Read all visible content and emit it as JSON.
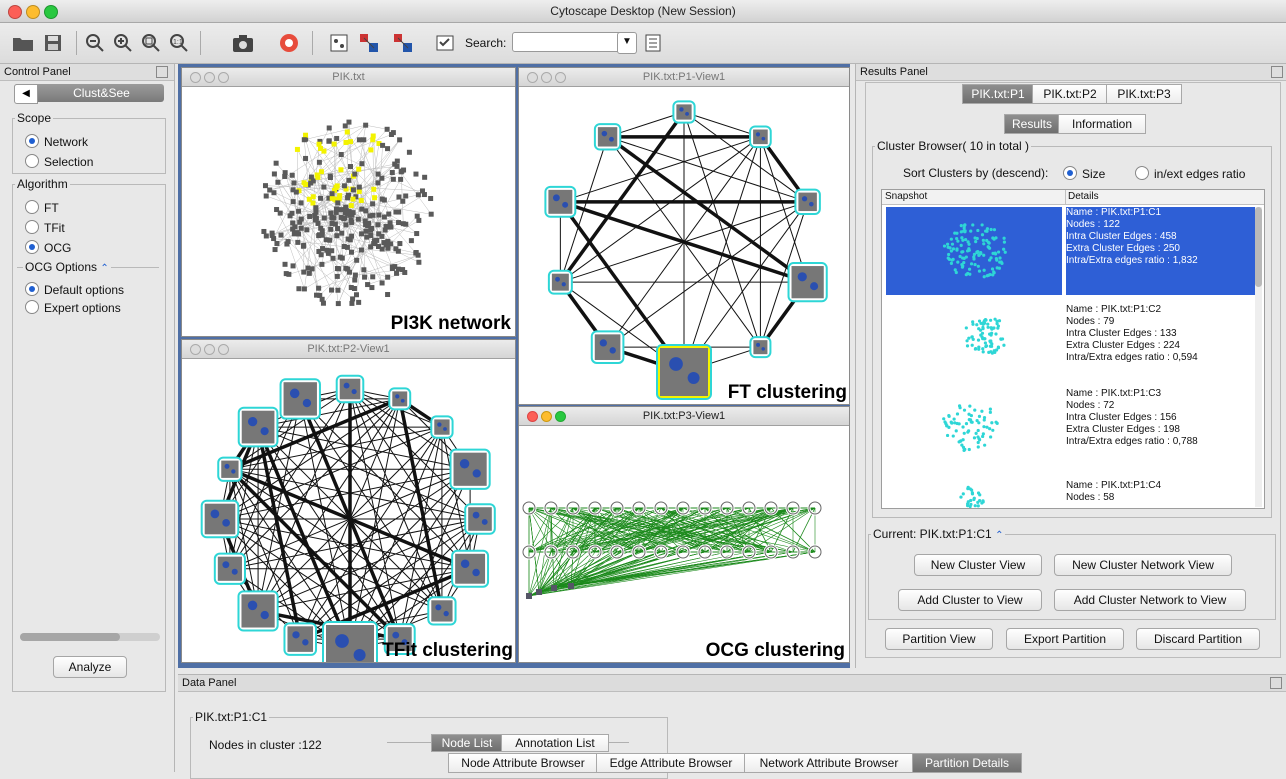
{
  "window": {
    "title": "Cytoscape Desktop (New Session)"
  },
  "toolbar": {
    "search_label": "Search:",
    "search_value": ""
  },
  "control_panel": {
    "title": "Control Panel",
    "tab_label": "Clust&See",
    "scope_legend": "Scope",
    "scope_options": [
      "Network",
      "Selection"
    ],
    "algorithm_legend": "Algorithm",
    "algorithm_options": [
      "FT",
      "TFit",
      "OCG"
    ],
    "ocg_options_legend": "OCG Options",
    "ocg_options": [
      "Default options",
      "Expert options"
    ],
    "analyze_label": "Analyze"
  },
  "network_views": {
    "pik": {
      "title": "PIK.txt",
      "caption": "PI3K network"
    },
    "p1": {
      "title": "PIK.txt:P1-View1",
      "caption": "FT clustering"
    },
    "p2": {
      "title": "PIK.txt:P2-View1",
      "caption": "TFit clustering"
    },
    "p3": {
      "title": "PIK.txt:P3-View1",
      "caption": "OCG clustering"
    }
  },
  "results_panel": {
    "title": "Results Panel",
    "partition_tabs": [
      "PIK.txt:P1",
      "PIK.txt:P2",
      "PIK.txt:P3"
    ],
    "sub_tabs": [
      "Results",
      "Information"
    ],
    "browser_legend": "Cluster Browser( 10 in total )",
    "sort_label": "Sort Clusters by (descend):",
    "sort_options": [
      "Size",
      "in/ext edges ratio"
    ],
    "col_snapshot": "Snapshot",
    "col_details": "Details",
    "clusters": [
      {
        "name": "Name : PIK.txt:P1:C1",
        "nodes": "Nodes : 122",
        "intra": "Intra Cluster Edges : 458",
        "extra": "Extra Cluster Edges : 250",
        "ratio": "Intra/Extra edges ratio : 1,832"
      },
      {
        "name": "Name : PIK.txt:P1:C2",
        "nodes": "Nodes : 79",
        "intra": "Intra Cluster Edges : 133",
        "extra": "Extra Cluster Edges : 224",
        "ratio": "Intra/Extra edges ratio : 0,594"
      },
      {
        "name": "Name : PIK.txt:P1:C3",
        "nodes": "Nodes : 72",
        "intra": "Intra Cluster Edges : 156",
        "extra": "Extra Cluster Edges : 198",
        "ratio": "Intra/Extra edges ratio : 0,788"
      },
      {
        "name": "Name : PIK.txt:P1:C4",
        "nodes": "Nodes : 58"
      }
    ],
    "current_legend": "Current: PIK.txt:P1:C1",
    "buttons": {
      "new_cluster_view": "New Cluster View",
      "new_cluster_network_view": "New Cluster Network View",
      "add_cluster_to_view": "Add Cluster to View",
      "add_cluster_network_to_view": "Add Cluster Network to View",
      "partition_view": "Partition View",
      "export_partition": "Export Partition",
      "discard_partition": "Discard Partition"
    }
  },
  "data_panel": {
    "title": "Data Panel",
    "legend": "PIK.txt:P1:C1",
    "nodes_in_cluster": "Nodes in cluster :122",
    "inner_tabs": [
      "Node List",
      "Annotation List"
    ],
    "bottom_tabs": [
      "Node Attribute Browser",
      "Edge Attribute Browser",
      "Network Attribute Browser",
      "Partition Details"
    ]
  },
  "colors": {
    "selection": "#2e5fd6",
    "node_cyan": "#2ed6d6",
    "highlight_yellow": "#f3f300",
    "ocg_green": "#1c8a1c"
  }
}
